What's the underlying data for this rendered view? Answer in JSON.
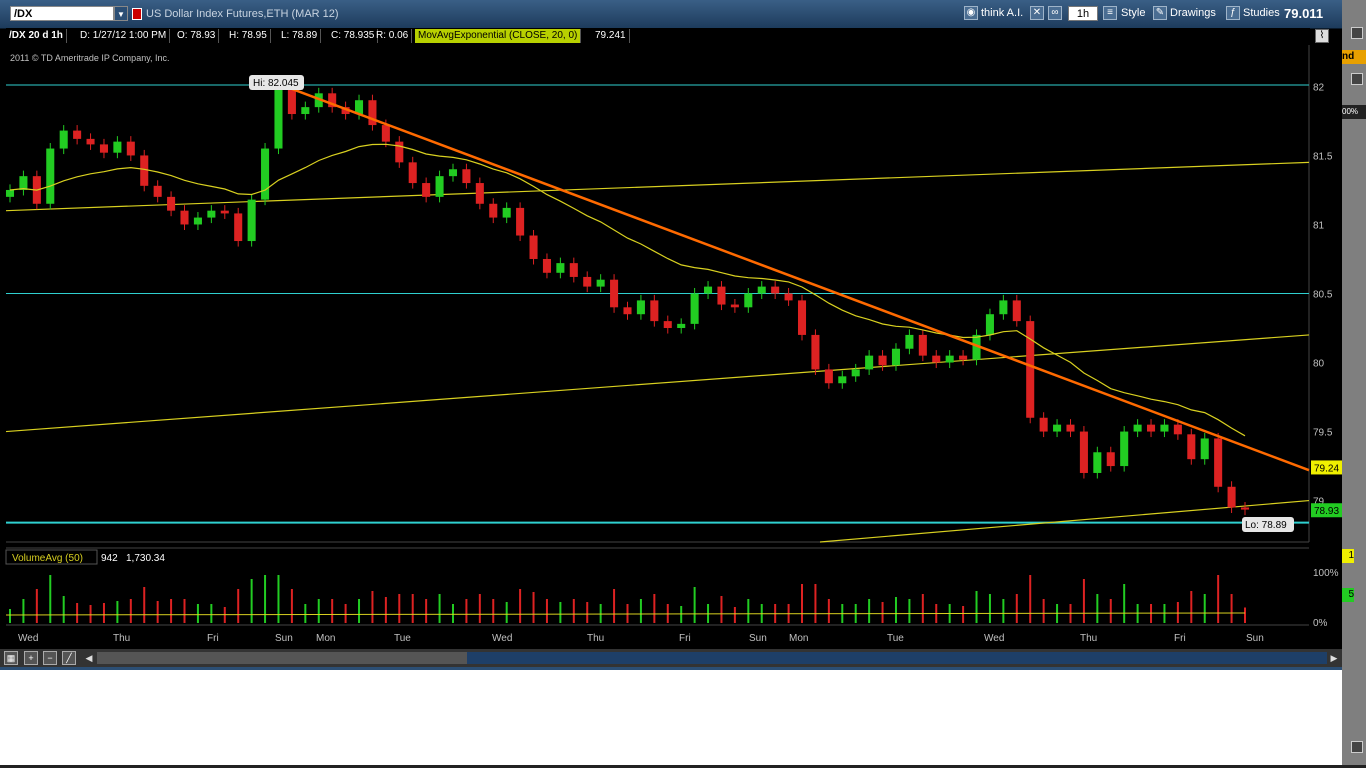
{
  "toolbar": {
    "symbol": "/DX",
    "description": "US Dollar Index Futures,ETH (MAR 12)",
    "think_label": "think A.I.",
    "timeframe": "1h",
    "style_label": "Style",
    "drawings_label": "Drawings",
    "studies_label": "Studies",
    "last_price": "79.011"
  },
  "info_bar": {
    "chart_id": "/DX 20 d 1h",
    "date": "D: 1/27/12 1:00 PM",
    "open": "O: 78.93",
    "high": "H: 78.95",
    "low": "L: 78.89",
    "close": "C: 78.935",
    "range": "R: 0.06",
    "study": "MovAvgExponential (CLOSE, 20, 0)",
    "study_value": "79.241"
  },
  "copyright": "2011 © TD Ameritrade IP Company, Inc.",
  "volume_bar": {
    "label": "VolumeAvg (50)",
    "value": "942",
    "avg": "1,730.34"
  },
  "right_panel": {
    "tag": "nd",
    "pct": "00%",
    "marker_top": "1",
    "marker_bottom": "5"
  },
  "colors": {
    "up": "#22cc22",
    "down": "#dd2222",
    "ema": "#d8d020",
    "trend": "#ff6a00",
    "channel": "#d8d020",
    "level": "#2fd0d0",
    "grid_text": "#c0c0c0"
  },
  "chart_data": [
    {
      "type": "candlestick",
      "title": "",
      "ylim": [
        78.7,
        82.3
      ],
      "y_ticks": [
        "82",
        "81.5",
        "81",
        "80.5",
        "80",
        "79.5",
        "79"
      ],
      "x_tick_labels": [
        "Wed",
        "Thu",
        "Fri",
        "Sun",
        "Mon",
        "Tue",
        "Wed",
        "Thu",
        "Fri",
        "Sun",
        "Mon",
        "Tue",
        "Wed",
        "Thu",
        "Fri",
        "Sun"
      ],
      "price_tags": {
        "ema": "79.24",
        "last": "78.93"
      },
      "hi_label": "Hi: 82.045",
      "lo_label": "Lo: 78.89",
      "horizontal_levels": [
        82.01,
        80.5,
        78.84
      ],
      "ema_period": 20,
      "closes": [
        81.25,
        81.35,
        81.15,
        81.55,
        81.68,
        81.62,
        81.58,
        81.52,
        81.6,
        81.5,
        81.28,
        81.2,
        81.1,
        81.0,
        81.05,
        81.1,
        81.08,
        80.88,
        81.18,
        81.55,
        82.0,
        81.8,
        81.85,
        81.95,
        81.85,
        81.8,
        81.9,
        81.72,
        81.6,
        81.45,
        81.3,
        81.2,
        81.35,
        81.4,
        81.3,
        81.15,
        81.05,
        81.12,
        80.92,
        80.75,
        80.65,
        80.72,
        80.62,
        80.55,
        80.6,
        80.4,
        80.35,
        80.45,
        80.3,
        80.25,
        80.28,
        80.5,
        80.55,
        80.42,
        80.4,
        80.5,
        80.55,
        80.5,
        80.45,
        80.2,
        79.95,
        79.85,
        79.9,
        79.95,
        80.05,
        79.98,
        80.1,
        80.2,
        80.05,
        80.0,
        80.05,
        80.02,
        80.2,
        80.35,
        80.45,
        80.3,
        79.6,
        79.5,
        79.55,
        79.5,
        79.2,
        79.35,
        79.25,
        79.5,
        79.55,
        79.5,
        79.55,
        79.48,
        79.3,
        79.45,
        79.1,
        78.95,
        78.935
      ],
      "volume_axis": [
        "100%",
        "0%"
      ]
    }
  ]
}
